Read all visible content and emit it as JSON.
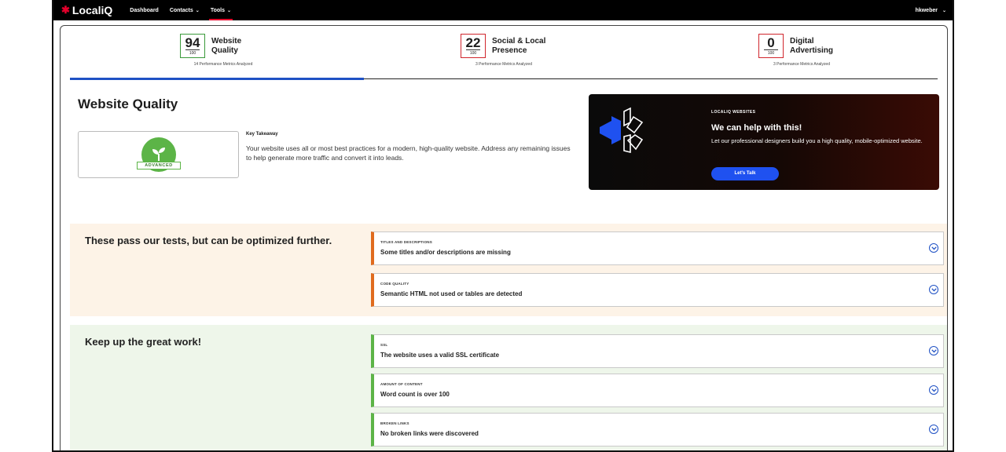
{
  "topbar": {
    "logo": "LocaliQ",
    "nav": [
      {
        "label": "Dashboard"
      },
      {
        "label": "Contacts"
      },
      {
        "label": "Tools"
      }
    ],
    "user": "hkweber"
  },
  "scores": [
    {
      "value": "94",
      "denominator": "100",
      "label": "Website Quality",
      "sub": "14 Performance Metrics Analyzed",
      "status_color": "#3a9a3a"
    },
    {
      "value": "22",
      "denominator": "100",
      "label": "Social & Local Presence",
      "sub": "3 Performance Metrics Analyzed",
      "status_color": "#d0262d"
    },
    {
      "value": "0",
      "denominator": "100",
      "label": "Digital Advertising",
      "sub": "3 Performance Metrics Analyzed",
      "status_color": "#d0262d"
    }
  ],
  "main": {
    "title": "Website Quality",
    "badge_label": "ADVANCED",
    "key_takeaway_heading": "Key Takeaway",
    "key_takeaway_text": "Your website uses all or most best practices for a modern, high-quality website. Address any remaining issues to help generate more traffic and convert it into leads."
  },
  "promo": {
    "eyebrow": "LOCALIQ WEBSITES",
    "heading": "We can help with this!",
    "body": "Let our professional designers build you a high quality, mobile-optimized website.",
    "button": "Let's Talk"
  },
  "optimize": {
    "title": "These pass our tests, but can be optimized further.",
    "items": [
      {
        "category": "TITLES AND DESCRIPTIONS",
        "text": "Some titles and/or descriptions are missing"
      },
      {
        "category": "CODE QUALITY",
        "text": "Semantic HTML not used or tables are detected"
      }
    ]
  },
  "great": {
    "title": "Keep up the great work!",
    "items": [
      {
        "category": "SSL",
        "text": "The website uses a valid SSL certificate"
      },
      {
        "category": "AMOUNT OF CONTENT",
        "text": "Word count is over 100"
      },
      {
        "category": "BROKEN LINKS",
        "text": "No broken links were discovered"
      }
    ]
  },
  "colors": {
    "brand_red": "#e4002b",
    "accent_blue": "#1f51c4",
    "optimize_orange": "#e06b1e",
    "pass_green": "#5cb447"
  }
}
